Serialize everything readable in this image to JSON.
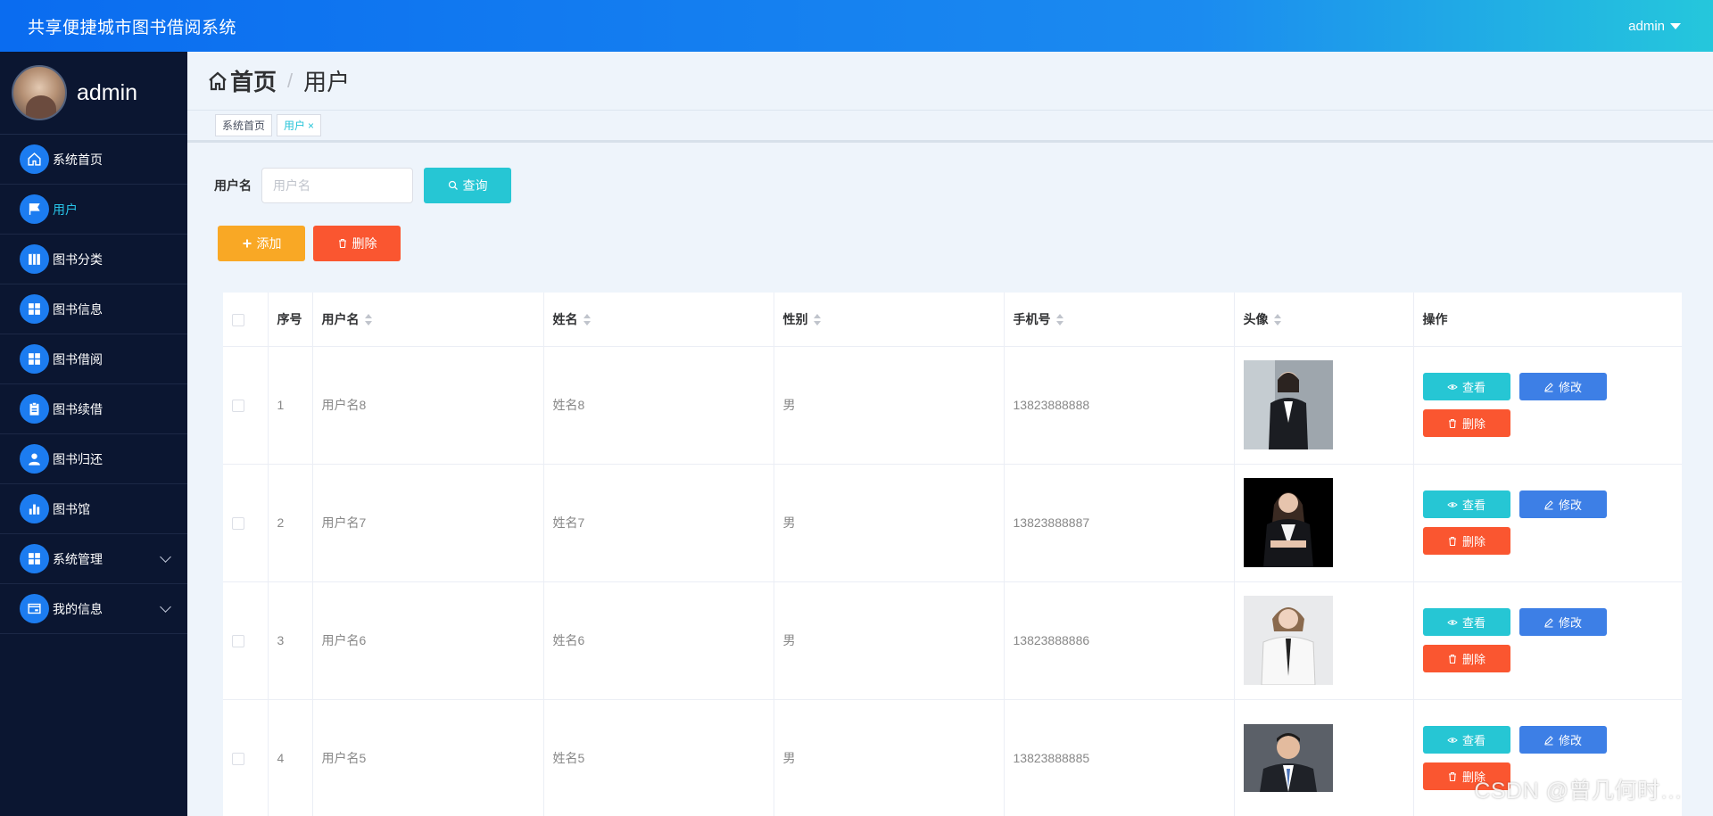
{
  "header": {
    "app_title": "共享便捷城市图书借阅系统",
    "user": "admin"
  },
  "sidebar": {
    "username": "admin",
    "items": [
      {
        "label": "系统首页",
        "icon": "home-icon"
      },
      {
        "label": "用户",
        "icon": "flag-icon"
      },
      {
        "label": "图书分类",
        "icon": "books-icon"
      },
      {
        "label": "图书信息",
        "icon": "grid-icon"
      },
      {
        "label": "图书借阅",
        "icon": "grid-icon"
      },
      {
        "label": "图书续借",
        "icon": "clipboard-icon"
      },
      {
        "label": "图书归还",
        "icon": "person-icon"
      },
      {
        "label": "图书馆",
        "icon": "bar-chart-icon"
      },
      {
        "label": "系统管理",
        "icon": "grid-icon"
      },
      {
        "label": "我的信息",
        "icon": "card-icon"
      }
    ]
  },
  "breadcrumb": {
    "home": "首页",
    "separator": "/",
    "current": "用户"
  },
  "tags": [
    {
      "label": "系统首页"
    },
    {
      "label": "用户",
      "close": "×"
    }
  ],
  "search": {
    "label": "用户名",
    "placeholder": "用户名",
    "button": "查询"
  },
  "actions": {
    "add": "添加",
    "delete": "删除"
  },
  "table": {
    "columns": [
      "序号",
      "用户名",
      "姓名",
      "性别",
      "手机号",
      "头像",
      "操作"
    ],
    "rows": [
      {
        "index": "1",
        "username": "用户名8",
        "name": "姓名8",
        "gender": "男",
        "phone": "13823888888"
      },
      {
        "index": "2",
        "username": "用户名7",
        "name": "姓名7",
        "gender": "男",
        "phone": "13823888887"
      },
      {
        "index": "3",
        "username": "用户名6",
        "name": "姓名6",
        "gender": "男",
        "phone": "13823888886"
      },
      {
        "index": "4",
        "username": "用户名5",
        "name": "姓名5",
        "gender": "男",
        "phone": "13823888885"
      }
    ],
    "row_actions": {
      "view": "查看",
      "edit": "修改",
      "remove": "删除"
    }
  },
  "watermark": "CSDN @曾几何时…",
  "colors": {
    "accent": "#26c6d4",
    "primary": "#1c7cf0",
    "danger": "#fa5630",
    "warning": "#f9a825",
    "sidebar_bg": "#0b1631"
  }
}
